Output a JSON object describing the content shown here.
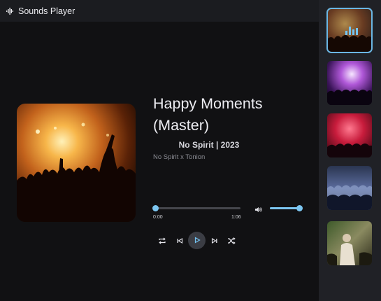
{
  "app": {
    "title": "Sounds Player",
    "icon": "sound-wave-icon"
  },
  "track": {
    "title_line1": "Happy Moments",
    "title_line2": "(Master)",
    "meta": "No Spirit | 2023",
    "artist": "No Spirit x Tonion",
    "cover": "concert-crowd-orange-image"
  },
  "progress": {
    "current_time": "0:00",
    "duration": "1:06",
    "fraction": 0.0
  },
  "volume": {
    "level": 1.0,
    "icon": "speaker-icon"
  },
  "controls": {
    "repeat": "repeat-icon",
    "previous": "skip-previous-icon",
    "play": "play-icon",
    "next": "skip-next-icon",
    "shuffle": "shuffle-icon"
  },
  "playlist": [
    {
      "art": "concert-orange-playing",
      "active": true
    },
    {
      "art": "concert-purple-lights",
      "active": false
    },
    {
      "art": "concert-red-lights",
      "active": false
    },
    {
      "art": "concert-blue-crowd",
      "active": false
    },
    {
      "art": "festival-green-crowd",
      "active": false
    }
  ],
  "colors": {
    "accent": "#7cc6f1",
    "background": "#111113",
    "sidebar": "#202126",
    "topbar": "#1b1c20"
  }
}
